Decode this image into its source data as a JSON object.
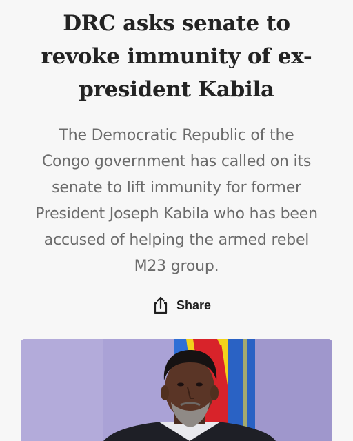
{
  "article": {
    "headline": "DRC asks senate to revoke immunity of ex-president Kabila",
    "summary": "The Democratic Republic of the Congo government has called on its senate to lift immunity for former President Joseph Kabila who has been accused of helping the armed rebel M23 group."
  },
  "share": {
    "label": "Share",
    "icon": "share-icon"
  },
  "colors": {
    "background": "#f7f7f7",
    "headline": "#232323",
    "summary": "#6b6b6b",
    "image_backdrop": "#a9a0d2",
    "flag_blue": "#2f6fd6",
    "flag_yellow": "#f2d21b",
    "flag_red": "#d8232a"
  }
}
